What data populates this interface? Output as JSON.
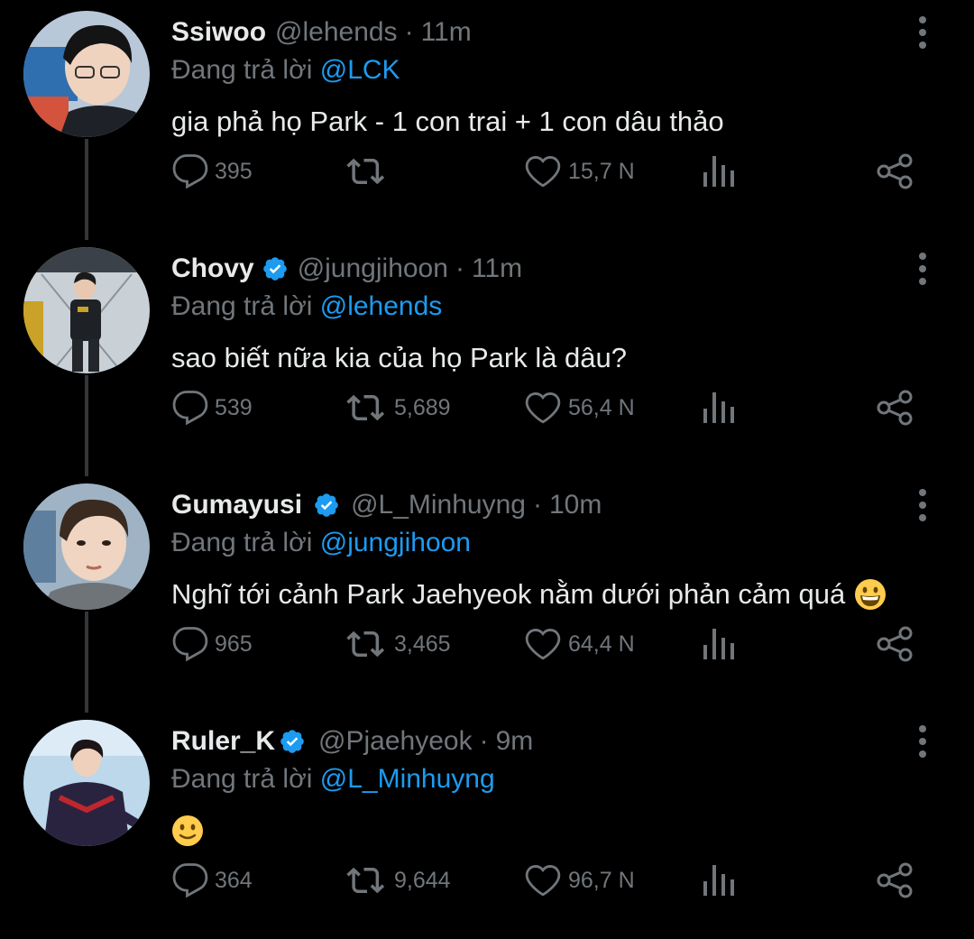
{
  "theme": {
    "background": "#000000",
    "text": "#e7e9ea",
    "muted": "#71767b",
    "accent": "#1d9bf0",
    "thread_line": "#333639"
  },
  "reply_prefix": "Đang trả lời",
  "tweets": [
    {
      "display_name": "Ssiwoo",
      "verified": false,
      "handle": "@lehends",
      "time": "11m",
      "reply_to": "@LCK",
      "text": "gia phả họ Park - 1 con trai + 1 con dâu thảo",
      "emoji": "",
      "replies": "395",
      "retweets": "",
      "likes": "15,7 N",
      "avatar_icon": "profile-photo"
    },
    {
      "display_name": "Chovy",
      "verified": true,
      "handle": "@jungjihoon",
      "time": "11m",
      "reply_to": "@lehends",
      "text": "sao biết nữa kia của họ Park là dâu?",
      "emoji": "",
      "replies": "539",
      "retweets": "5,689",
      "likes": "56,4 N",
      "avatar_icon": "profile-photo"
    },
    {
      "display_name": "Gumayusi",
      "verified": true,
      "handle": "@L_Minhuyng",
      "time": "10m",
      "reply_to": "@jungjihoon",
      "text": "Nghĩ tới cảnh Park Jaehyeok nằm dưới phản cảm quá",
      "emoji": "grinning-face-emoji",
      "replies": "965",
      "retweets": "3,465",
      "likes": "64,4 N",
      "avatar_icon": "profile-photo"
    },
    {
      "display_name": "Ruler_K",
      "verified": true,
      "handle": "@Pjaehyeok",
      "time": "9m",
      "reply_to": "@L_Minhuyng",
      "text": "",
      "emoji": "slightly-smiling-face-emoji",
      "replies": "364",
      "retweets": "9,644",
      "likes": "96,7 N",
      "avatar_icon": "profile-photo"
    }
  ],
  "separator": "·"
}
